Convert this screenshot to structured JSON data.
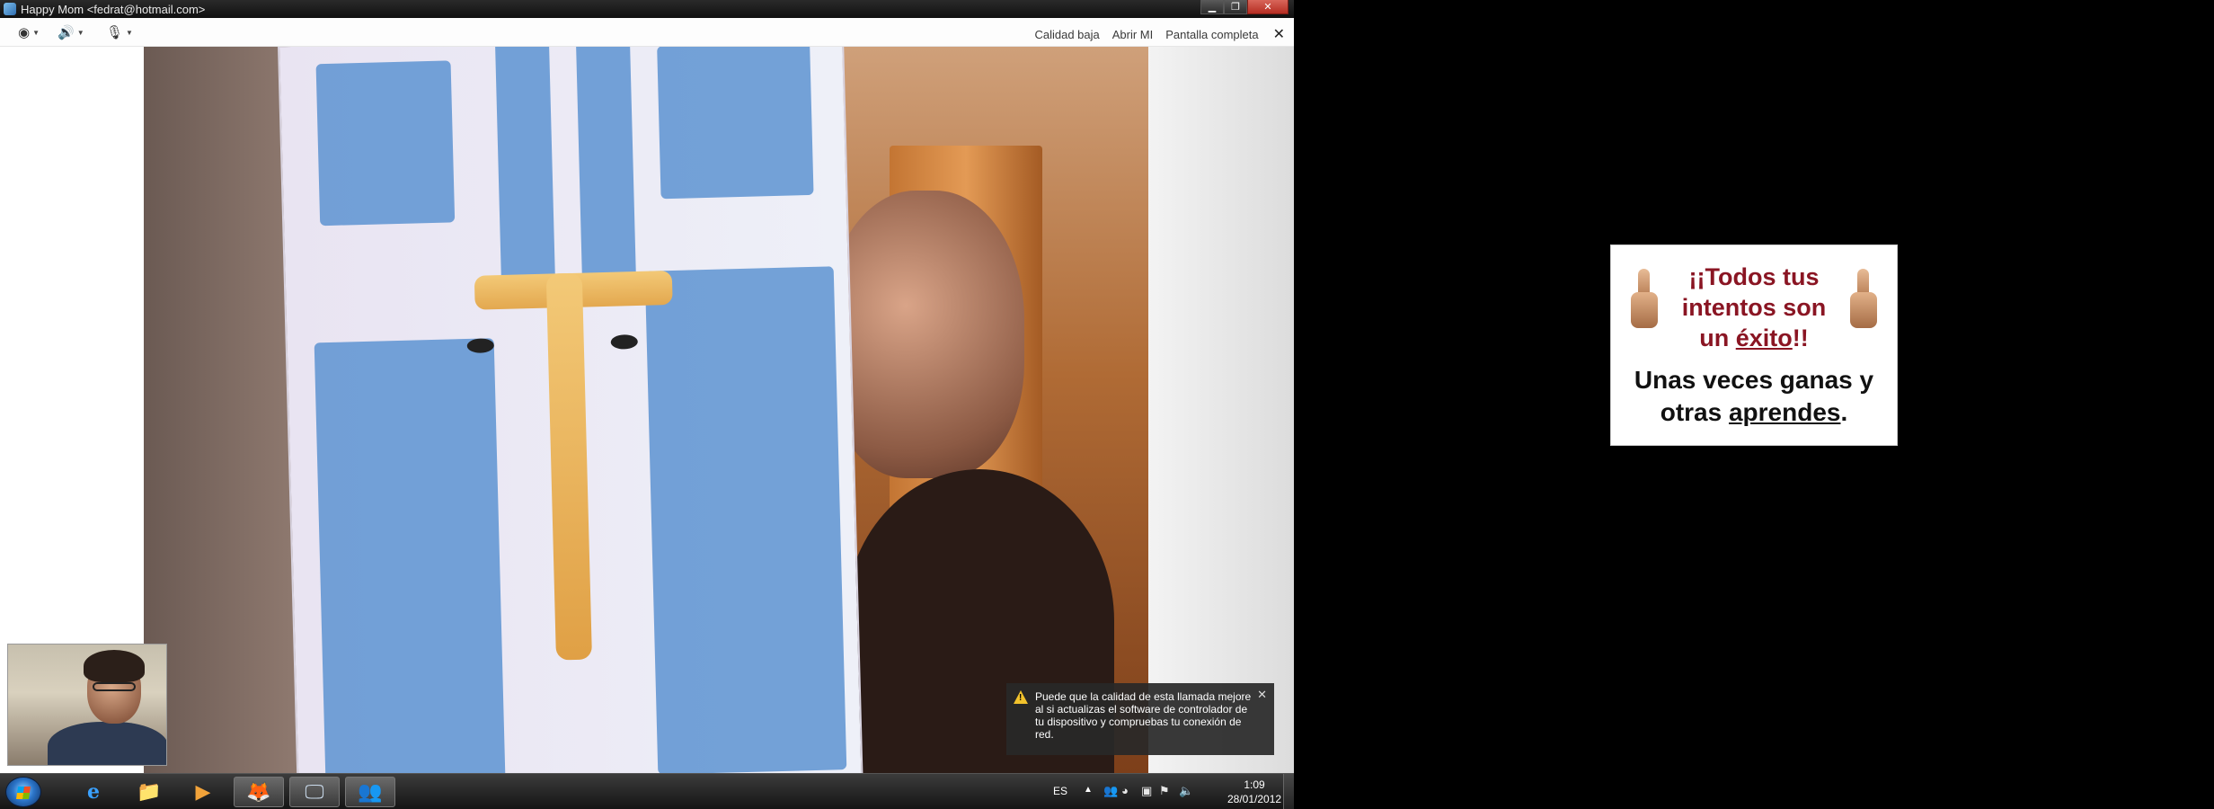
{
  "window": {
    "title": "Happy Mom <fedrat@hotmail.com>",
    "controls": {
      "minimize": "▁",
      "maximize": "❐",
      "close": "✕"
    }
  },
  "toolbar": {
    "webcam_icon": "webcam-icon",
    "speaker_icon": "speaker-icon",
    "mic_icon": "microphone-icon",
    "links": {
      "low_quality": "Calidad baja",
      "open_mi": "Abrir MI",
      "fullscreen": "Pantalla completa",
      "close": "✕"
    }
  },
  "notification": {
    "text": "Puede que la calidad de esta llamada mejore al si actualizas el software de controlador de tu dispositivo y compruebas tu conexión de red.",
    "close": "✕"
  },
  "taskbar": {
    "pinned": [
      {
        "name": "internet-explorer",
        "glyph": "e"
      },
      {
        "name": "file-explorer",
        "glyph": "📁"
      },
      {
        "name": "media-player",
        "glyph": "▶"
      },
      {
        "name": "firefox",
        "glyph": "🦊"
      },
      {
        "name": "window-app",
        "glyph": "🖵"
      },
      {
        "name": "messenger",
        "glyph": "👥"
      }
    ],
    "tray": {
      "language": "ES",
      "time": "1:09",
      "date": "28/01/2012"
    }
  },
  "card": {
    "line1_prefix": "¡¡Todos tus intentos son un ",
    "line1_emph": "éxito",
    "line1_suffix": "!!",
    "line2_prefix": "Unas veces ganas y otras ",
    "line2_emph": "aprendes",
    "line2_suffix": "."
  },
  "colors": {
    "card_headline": "#8a1523",
    "notification_bg": "#282828",
    "warning": "#f2c22c"
  }
}
